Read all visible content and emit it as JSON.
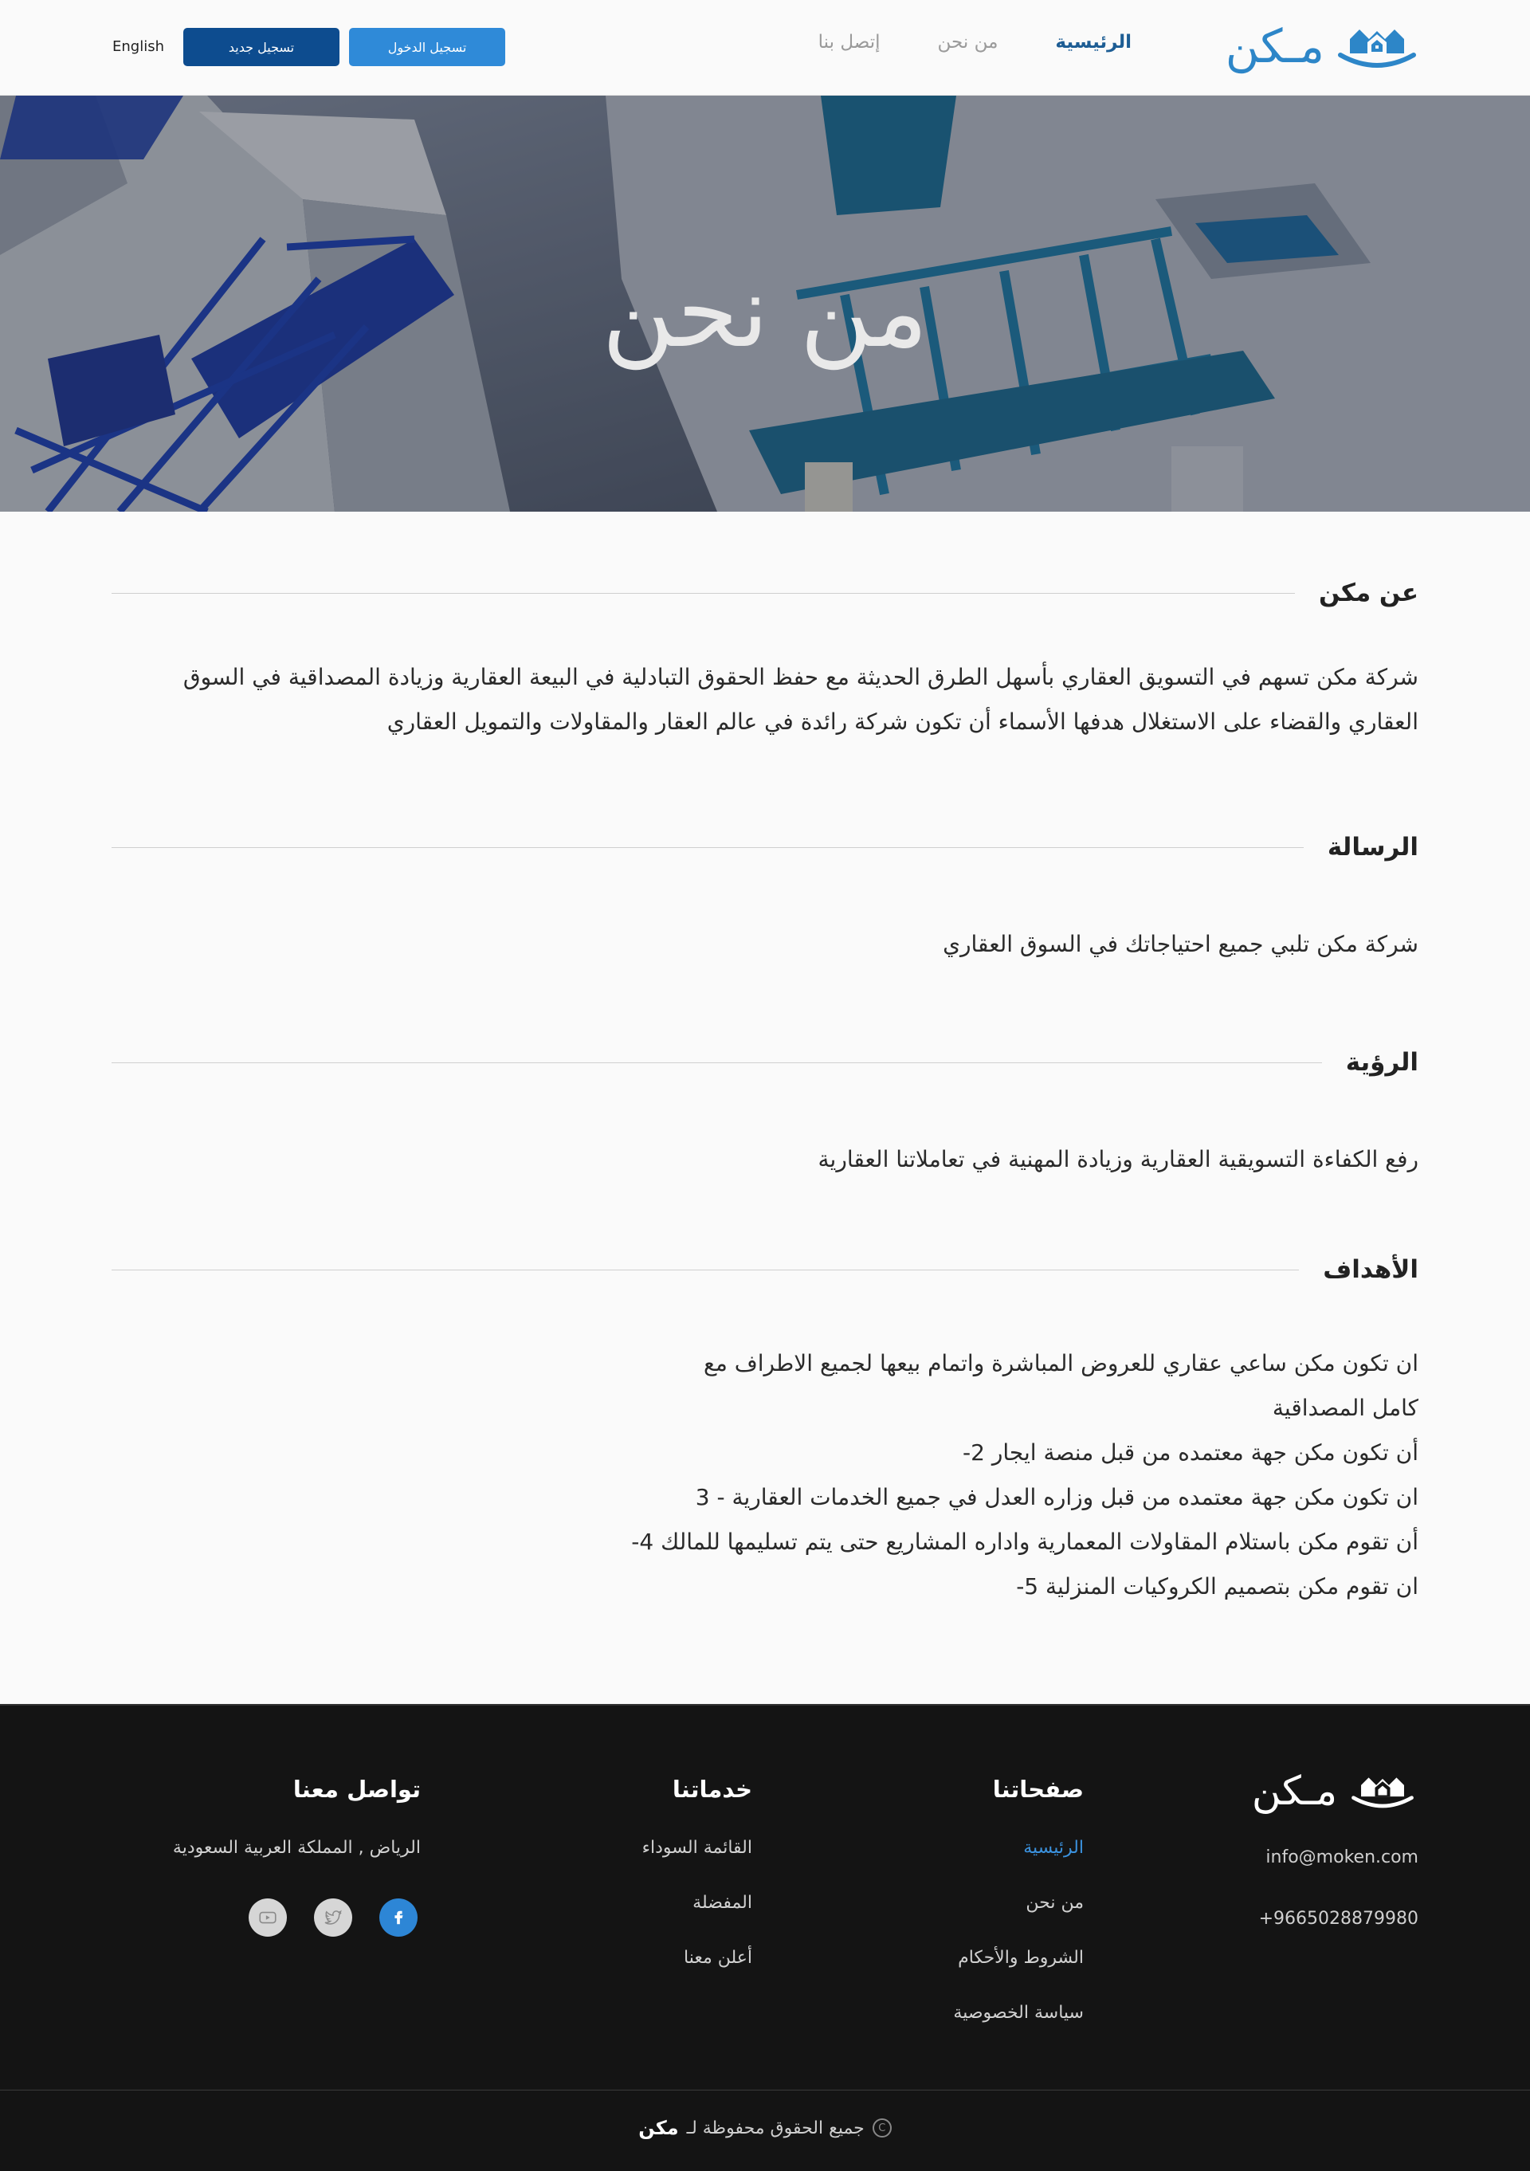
{
  "header": {
    "logo_text": "مـكن",
    "nav": [
      "الرئيسية",
      "من نحن",
      "إتصل بنا"
    ],
    "login_label": "تسجيل الدخول",
    "register_label": "تسجيل جديد",
    "language_label": "English"
  },
  "hero": {
    "title": "من نحن"
  },
  "sections": [
    {
      "title": "عن مكن",
      "body": [
        "شركة مكن تسهم في التسويق العقاري بأسهل الطرق الحديثة مع حفظ الحقوق التبادلية في البيعة العقارية وزيادة المصداقية في السوق",
        "العقاري والقضاء على الاستغلال هدفها الأسماء أن تكون شركة رائدة في عالم العقار والمقاولات والتمويل العقاري"
      ]
    },
    {
      "title": "الرسالة",
      "body": [
        "شركة مكن تلبي جميع احتياجاتك في السوق العقاري"
      ]
    },
    {
      "title": "الرؤية",
      "body": [
        "رفع الكفاءة التسويقية العقارية وزيادة المهنية في تعاملاتنا العقارية"
      ]
    },
    {
      "title": "الأهداف",
      "body": [
        "ان تكون مكن ساعي عقاري للعروض المباشرة واتمام بيعها لجميع الاطراف مع",
        "كامل المصداقية",
        "أن تكون مكن جهة معتمده من قبل منصة ايجار 2-",
        "ان تكون مكن جهة معتمده من قبل وزاره العدل في جميع الخدمات العقارية - 3",
        "أن تقوم مكن باستلام المقاولات المعمارية واداره المشاريع حتى يتم تسليمها للمالك 4-",
        "ان تقوم مكن بتصميم الكروكيات المنزلية 5-"
      ]
    }
  ],
  "footer": {
    "logo_text": "مـكن",
    "email": "info@moken.com",
    "phone": "+9665028879980",
    "pages_title": "صفحاتنا",
    "pages": [
      "الرئيسية",
      "من نحن",
      "الشروط والأحكام",
      "سياسة الخصوصية"
    ],
    "services_title": "خدماتنا",
    "services": [
      "القائمة السوداء",
      "المفضلة",
      "أعلن معنا"
    ],
    "contact_title": "تواصل معنا",
    "address": "الرياض , المملكة العربية السعودية",
    "copyright_text": "جميع الحقوق محفوظة لـ",
    "copyright_brand": "مكن"
  },
  "colors": {
    "primary_dark": "#0d4c8f",
    "primary": "#2f8ad8",
    "accent_nav": "#1d5d94",
    "footer_bg": "#141414"
  },
  "icons": [
    "logo-house-icon",
    "youtube-icon",
    "twitter-icon",
    "facebook-icon",
    "copyright-icon"
  ]
}
